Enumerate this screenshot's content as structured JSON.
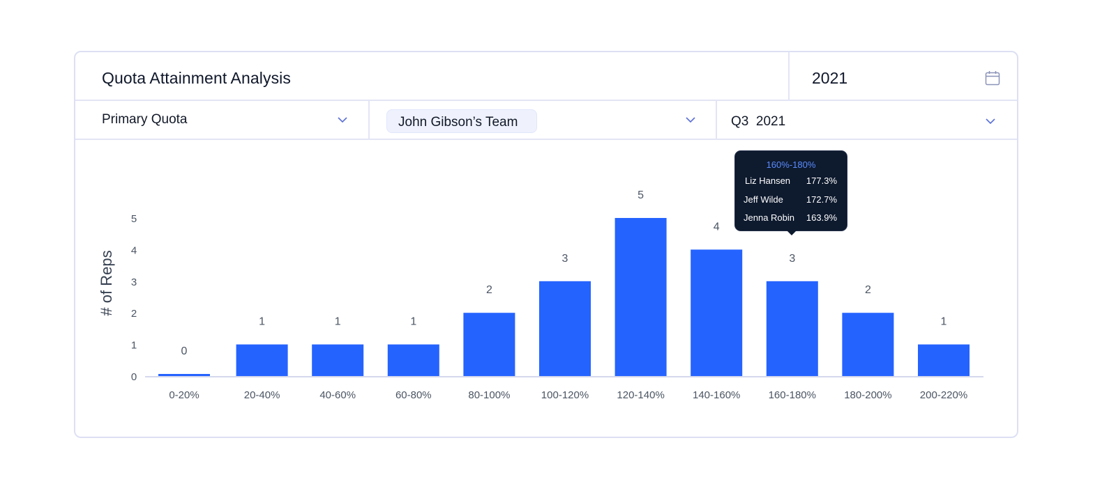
{
  "header": {
    "title": "Quota Attainment Analysis",
    "year": "2021",
    "calendar_icon": "calendar-icon"
  },
  "filters": {
    "quota": "Primary Quota",
    "team": "John Gibson’s Team",
    "period": "Q3  2021"
  },
  "colors": {
    "bar": "#2563ff",
    "axis": "#d5d8ee",
    "text": "#4b5563",
    "tooltip_bg": "#0e1a2e",
    "tooltip_accent": "#5b8cff"
  },
  "chart_data": {
    "type": "bar",
    "ylabel": "# of Reps",
    "xlabel": "",
    "categories": [
      "0-20%",
      "20-40%",
      "40-60%",
      "60-80%",
      "80-100%",
      "100-120%",
      "120-140%",
      "140-160%",
      "160-180%",
      "180-200%",
      "200-220%"
    ],
    "values": [
      0,
      1,
      1,
      1,
      2,
      3,
      5,
      4,
      3,
      2,
      1
    ],
    "y_ticks": [
      0,
      1,
      2,
      3,
      4,
      5
    ],
    "ylim": [
      0,
      5
    ],
    "grid": false,
    "data_labels": true
  },
  "tooltip": {
    "title": "160%-180%",
    "rows": [
      {
        "name": "Liz Hansen",
        "value": "177.3%"
      },
      {
        "name": "Jeff Wilde",
        "value": "172.7%"
      },
      {
        "name": "Jenna Robin",
        "value": "163.9%"
      }
    ]
  }
}
